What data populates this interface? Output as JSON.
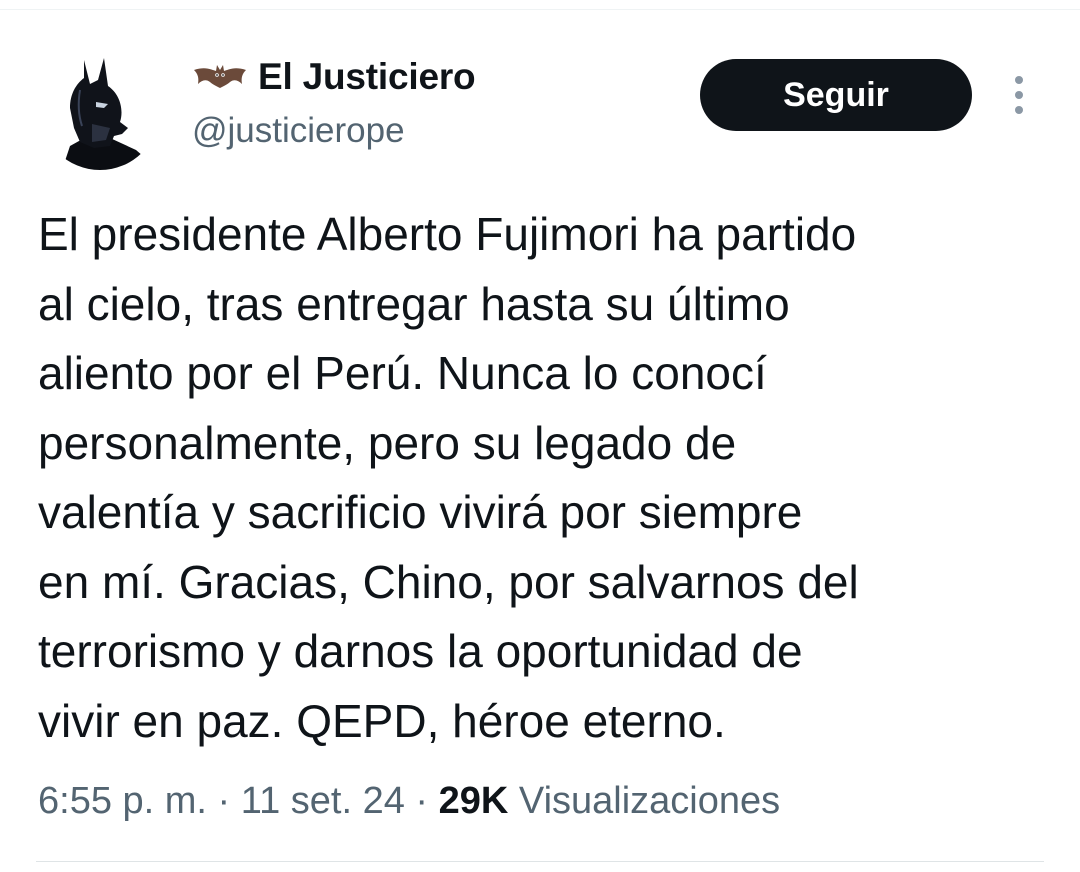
{
  "author": {
    "display_name": "El Justiciero",
    "handle": "@justicierope",
    "name_emoji": "🦇",
    "avatar_icon": "batman-avatar-icon"
  },
  "actions": {
    "follow_label": "Seguir",
    "more_icon": "more-vertical-icon"
  },
  "tweet": {
    "lines": [
      "El presidente Alberto Fujimori ha partido",
      "al cielo, tras entregar hasta su último",
      "aliento por el Perú. Nunca lo conocí",
      "personalmente, pero su legado de",
      "valentía y sacrificio vivirá por siempre",
      "en mí. Gracias, Chino, por salvarnos del",
      "terrorismo y darnos la oportunidad de",
      "vivir en paz. QEPD, héroe eterno."
    ]
  },
  "meta": {
    "time": "6:55 p. m.",
    "separator": " · ",
    "date": "11 set. 24",
    "views_count": "29K",
    "views_label": "Visualizaciones"
  },
  "colors": {
    "text_primary": "#0f1419",
    "text_secondary": "#536471",
    "button_bg": "#0f1419",
    "button_text": "#ffffff"
  }
}
